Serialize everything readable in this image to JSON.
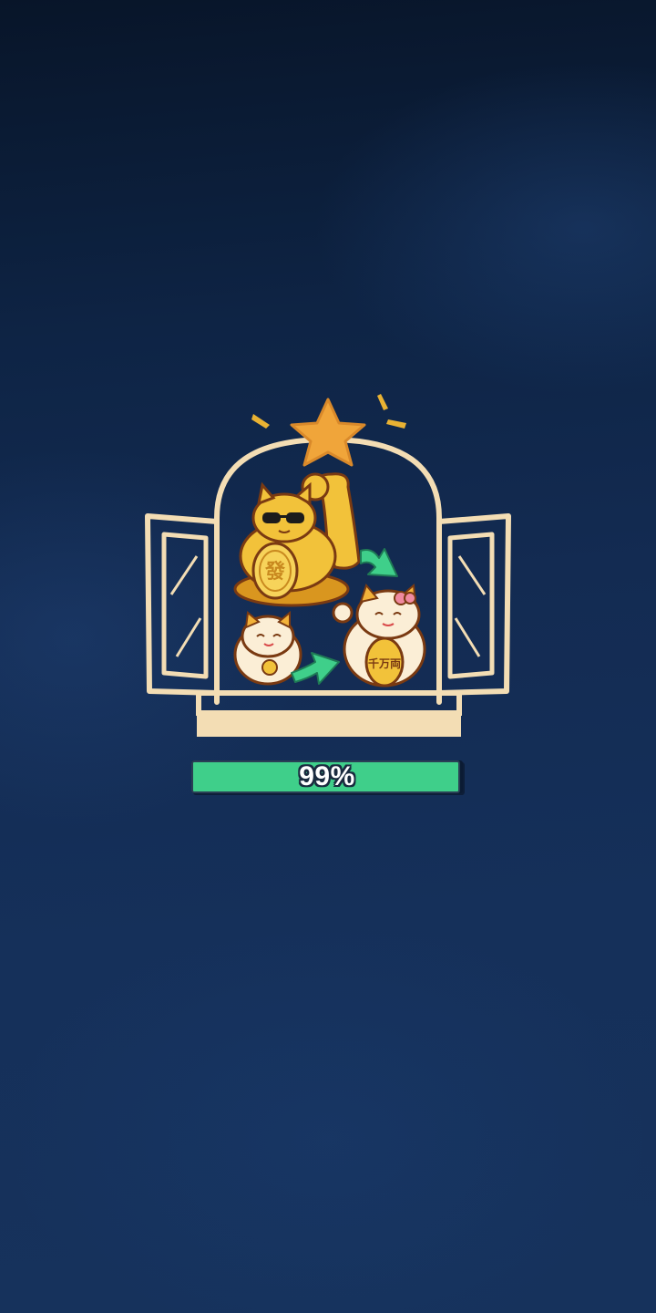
{
  "loading": {
    "progress_percent": 99,
    "progress_label": "99%"
  },
  "illustration": {
    "big_cat_coin_text": "發",
    "small_cat_coin_text": "千万両"
  },
  "colors": {
    "progress_fill": "#3fcf8a",
    "window_frame": "#f3ddb4",
    "star": "#f0a53a",
    "arrow": "#3fcf8a",
    "gold": "#e9a928"
  },
  "icons": [
    "star-icon",
    "window-icon",
    "lucky-cat-icon",
    "upgrade-arrow-icon"
  ]
}
